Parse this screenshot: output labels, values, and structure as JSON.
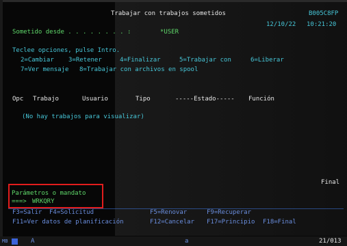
{
  "header": {
    "title": "Trabajar con trabajos sometidos",
    "system": "B005C8FP",
    "date": "12/10/22",
    "time": "10:21:20"
  },
  "filter": {
    "label": "Sometido desde . . . . . . . . :",
    "value": "*USER"
  },
  "instructions": {
    "line1": "Teclee opciones, pulse Intro.",
    "options_row1": [
      "2=Cambiar",
      "3=Retener",
      "4=Finalizar",
      "5=Trabajar con",
      "6=Liberar"
    ],
    "options_row2": [
      "7=Ver mensaje",
      "8=Trabajar con archivos en spool"
    ]
  },
  "columns": [
    "Opc",
    "Trabajo",
    "Usuario",
    "Tipo",
    "-----Estado-----",
    "Función"
  ],
  "empty_message": "(No hay trabajos para visualizar)",
  "final_label": "Final",
  "command": {
    "label": "Parámetros o mandato",
    "prompt": "===>",
    "value": "WRKQRY"
  },
  "function_keys": {
    "row1": [
      "F3=Salir",
      "F4=Solicitud",
      "F5=Renovar",
      "F9=Recuperar"
    ],
    "row2": [
      "F11=Ver datos de planificación",
      "F12=Cancelar",
      "F17=Principio",
      "F18=Final"
    ]
  },
  "status_bar": {
    "indicator": "MB",
    "left_marker": "A",
    "mid_marker": "a",
    "position": "21/013"
  },
  "colors": {
    "title_white": "#e8e8e8",
    "field_cyan": "#47c7d9",
    "input_green": "#5fd86a",
    "function_blue": "#6b8fe0",
    "highlight_red": "#e21d1d"
  }
}
